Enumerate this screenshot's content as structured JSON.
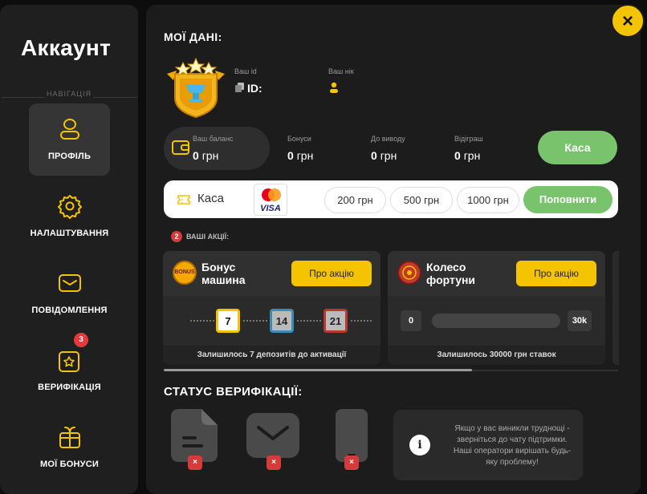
{
  "sidebar": {
    "title": "Аккаунт",
    "nav_header": "НАВІГАЦІЯ",
    "items": [
      {
        "label": "ПРОФІЛЬ"
      },
      {
        "label": "НАЛАШТУВАННЯ"
      },
      {
        "label": "ПОВІДОМЛЕННЯ"
      },
      {
        "label": "ВЕРИФІКАЦІЯ",
        "badge": "3"
      },
      {
        "label": "МОЇ БОНУСИ"
      }
    ]
  },
  "close": "×",
  "profile": {
    "heading": "МОЇ ДАНІ:",
    "id_label": "Ваш id",
    "id_prefix": "ID:",
    "nick_label": "Ваш нік"
  },
  "balance": {
    "items": [
      {
        "label": "Ваш баланс",
        "value": "0",
        "unit": "грн"
      },
      {
        "label": "Бонуси",
        "value": "0",
        "unit": "грн"
      },
      {
        "label": "До виводу",
        "value": "0",
        "unit": "грн"
      },
      {
        "label": "Відіграш",
        "value": "0",
        "unit": "грн"
      }
    ],
    "cashier_button": "Каса"
  },
  "deposit": {
    "label": "Каса",
    "card_text": "VISA",
    "amounts": [
      "200 грн",
      "500 грн",
      "1000 грн"
    ],
    "topup_button": "Поповнити"
  },
  "promos": {
    "count": "2",
    "heading": "ВАШІ АКЦІЇ:",
    "cards": [
      {
        "title_line1": "Бонус",
        "title_line2": "машина",
        "logo_text": "BONUS",
        "button": "Про акцію",
        "dice": [
          "7",
          "14",
          "21"
        ],
        "footer": "Залишилось 7 депозитів до активації"
      },
      {
        "title_line1": "Колесо",
        "title_line2": "фортуни",
        "button": "Про акцію",
        "progress_min": "0",
        "progress_max": "30k",
        "progress": 0,
        "footer": "Залишилось 30000 грн ставок"
      }
    ]
  },
  "verification": {
    "heading": "СТАТУС ВЕРИФІКАЦІЇ:",
    "items": [
      {
        "icon": "document-icon",
        "status": "×"
      },
      {
        "icon": "email-icon",
        "status": "×"
      },
      {
        "icon": "phone-icon",
        "status": "×"
      }
    ],
    "help_text": "Якщо у вас виникли труднощі - зверніться до чату підтримки. Наші оператори вирішать будь-яку проблему!",
    "info_symbol": "i"
  },
  "colors": {
    "accent": "#f5c400",
    "green": "#7ac36d",
    "danger": "#d63a3a"
  }
}
